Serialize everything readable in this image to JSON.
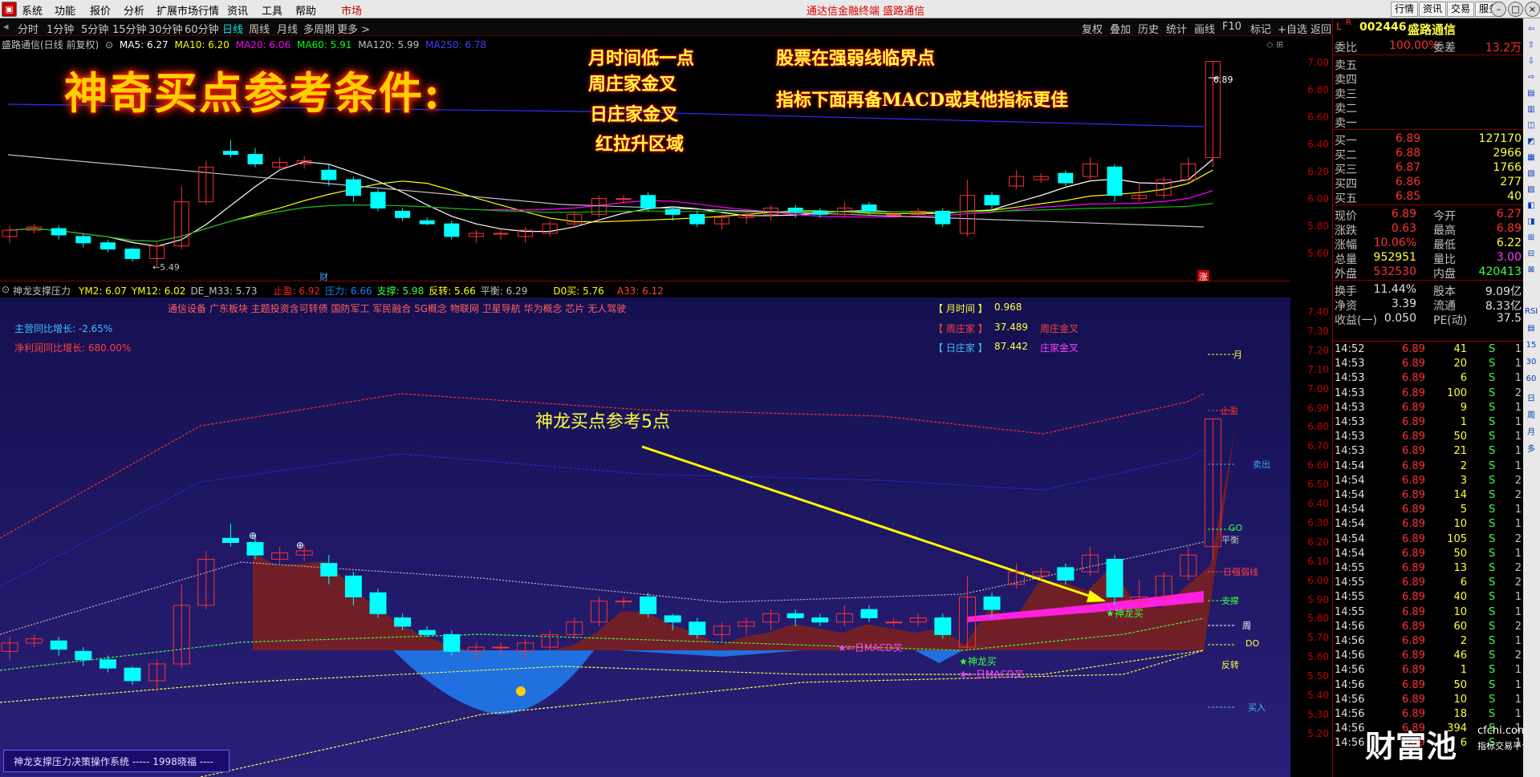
{
  "menubar": {
    "items": [
      "系统",
      "功能",
      "报价",
      "分析",
      "扩展市场行情",
      "资讯",
      "工具",
      "帮助"
    ],
    "market": "市场",
    "center_title": "通达信金融终端  盛路通信",
    "right_buttons": [
      "行情",
      "资讯",
      "交易",
      "服务"
    ]
  },
  "toolbar": {
    "periods": [
      "分时",
      "1分钟",
      "5分钟",
      "15分钟",
      "30分钟",
      "60分钟",
      "日线",
      "周线",
      "月线",
      "多周期",
      "更多 >"
    ],
    "active_period": "日线",
    "right_items": [
      "复权",
      "叠加",
      "历史",
      "统计",
      "画线",
      "F10",
      "标记",
      "+自选",
      "返回"
    ]
  },
  "main_chart": {
    "legend_title": "盛路通信(日线 前复权)",
    "legend": [
      {
        "label": "MA5: 6.27",
        "color": "#ffffff"
      },
      {
        "label": "MA10: 6.20",
        "color": "#ffff00"
      },
      {
        "label": "MA20: 6.06",
        "color": "#ff00ff"
      },
      {
        "label": "MA60: 5.91",
        "color": "#00ff00"
      },
      {
        "label": "MA120: 5.99",
        "color": "#c0c0c0"
      },
      {
        "label": "MA250: 6.78",
        "color": "#4040ff"
      }
    ],
    "big_title": "神奇买点参考条件:",
    "conditions_left": [
      "月时间低一点",
      "周庄家金叉",
      "日庄家金叉",
      "红拉升区域"
    ],
    "conditions_right": [
      "股票在强弱线临界点",
      "指标下面再备MACD或其他指标更佳"
    ],
    "high_label": "6.89",
    "low_label": "←5.49",
    "cai_label": "财",
    "zhang_label": "涨",
    "axis": [
      "7.00",
      "6.80",
      "6.60",
      "6.40",
      "6.20",
      "6.00",
      "5.80",
      "5.60"
    ]
  },
  "indicator": {
    "name": "神龙支撑压力",
    "params": [
      {
        "label": "YM2: 6.07",
        "color": "#ffff00"
      },
      {
        "label": "YM12: 6.02",
        "color": "#ffff00"
      },
      {
        "label": "DE_M33: 5.73",
        "color": "#c0c0c0"
      },
      {
        "label": "止盈: 6.92",
        "color": "#ff2020"
      },
      {
        "label": "压力: 6.66",
        "color": "#2080ff"
      },
      {
        "label": "支撑: 5.98",
        "color": "#40ff40"
      },
      {
        "label": "反转: 5.66",
        "color": "#ffff00"
      },
      {
        "label": "平衡: 6.29",
        "color": "#c0c0c0"
      },
      {
        "label": "D0买: 5.76",
        "color": "#ffff00"
      },
      {
        "label": "A33: 6.12",
        "color": "#ff4040"
      }
    ],
    "concepts": "通信设备 广东板块 主题投资含可转债 国防军工 军民融合 5G概念 物联网 卫星导航 华为概念 芯片 无人驾驶",
    "growth1": "主营同比增长: -2.65%",
    "growth2": "净利润同比增长: 680.00%",
    "info_rows": [
      {
        "tag": "【 月时间 】",
        "value": "0.968",
        "extra": ""
      },
      {
        "tag": "【 周庄家 】",
        "value": "37.489",
        "extra": "周庄金叉"
      },
      {
        "tag": "【 日庄家 】",
        "value": "87.442",
        "extra": "庄家金叉"
      }
    ],
    "annotation": "神龙买点参考5点",
    "labels": {
      "yue": "月",
      "zhiying": "止盈",
      "maichu": "卖出",
      "go": "GO",
      "pingheng": "平衡",
      "rqrx": "日强弱线",
      "zhicheng": "支撑",
      "zhou": "周",
      "do": "DO",
      "fanzhuan": "反转",
      "mairu": "买入",
      "shenlong1": "★神龙买",
      "shenlong2": "★神龙买",
      "macd1": "★←日MACD叉",
      "macd2": "★←日MACD叉"
    },
    "axis": [
      "7.40",
      "7.30",
      "7.20",
      "7.10",
      "7.00",
      "6.90",
      "6.80",
      "6.70",
      "6.60",
      "6.50",
      "6.40",
      "6.30",
      "6.20",
      "6.10",
      "6.00",
      "5.90",
      "5.80",
      "5.70",
      "5.60",
      "5.50",
      "5.40",
      "5.30",
      "5.20"
    ],
    "status": "神龙支撑压力决策操作系统  -----  1998晓福  ----"
  },
  "quote": {
    "code": "002446",
    "name": "盛路通信",
    "webi_label": "委比",
    "webi_value": "100.00%",
    "weicha_label": "委差",
    "weicha_value": "13.2万",
    "sells": [
      "卖五",
      "卖四",
      "卖三",
      "卖二",
      "卖一"
    ],
    "buys": [
      {
        "label": "买一",
        "price": "6.89",
        "vol": "127170"
      },
      {
        "label": "买二",
        "price": "6.88",
        "vol": "2966"
      },
      {
        "label": "买三",
        "price": "6.87",
        "vol": "1766"
      },
      {
        "label": "买四",
        "price": "6.86",
        "vol": "277"
      },
      {
        "label": "买五",
        "price": "6.85",
        "vol": "40"
      }
    ],
    "stats": [
      {
        "l1": "现价",
        "v1": "6.89",
        "l2": "今开",
        "v2": "6.27",
        "c1": "#ff3030",
        "c2": "#ff3030"
      },
      {
        "l1": "涨跌",
        "v1": "0.63",
        "l2": "最高",
        "v2": "6.89",
        "c1": "#ff3030",
        "c2": "#ff3030"
      },
      {
        "l1": "涨幅",
        "v1": "10.06%",
        "l2": "最低",
        "v2": "6.22",
        "c1": "#ff3030",
        "c2": "#ffff40"
      },
      {
        "l1": "总量",
        "v1": "952951",
        "l2": "量比",
        "v2": "3.00",
        "c1": "#ffff40",
        "c2": "#ff40ff"
      },
      {
        "l1": "外盘",
        "v1": "532530",
        "l2": "内盘",
        "v2": "420413",
        "c1": "#ff3030",
        "c2": "#40ff40"
      }
    ],
    "stats2": [
      {
        "l1": "换手",
        "v1": "11.44%",
        "l2": "股本",
        "v2": "9.09亿"
      },
      {
        "l1": "净资",
        "v1": "3.39",
        "l2": "流通",
        "v2": "8.33亿"
      },
      {
        "l1": "收益(一)",
        "v1": "0.050",
        "l2": "PE(动)",
        "v2": "37.5"
      }
    ],
    "ticks": [
      [
        "14:52",
        "6.89",
        "41",
        "S",
        "1"
      ],
      [
        "14:53",
        "6.89",
        "20",
        "S",
        "1"
      ],
      [
        "14:53",
        "6.89",
        "6",
        "S",
        "1"
      ],
      [
        "14:53",
        "6.89",
        "100",
        "S",
        "2"
      ],
      [
        "14:53",
        "6.89",
        "9",
        "S",
        "1"
      ],
      [
        "14:53",
        "6.89",
        "1",
        "S",
        "1"
      ],
      [
        "14:53",
        "6.89",
        "50",
        "S",
        "1"
      ],
      [
        "14:53",
        "6.89",
        "21",
        "S",
        "1"
      ],
      [
        "14:54",
        "6.89",
        "2",
        "S",
        "1"
      ],
      [
        "14:54",
        "6.89",
        "3",
        "S",
        "2"
      ],
      [
        "14:54",
        "6.89",
        "14",
        "S",
        "2"
      ],
      [
        "14:54",
        "6.89",
        "5",
        "S",
        "1"
      ],
      [
        "14:54",
        "6.89",
        "10",
        "S",
        "1"
      ],
      [
        "14:54",
        "6.89",
        "105",
        "S",
        "2"
      ],
      [
        "14:54",
        "6.89",
        "50",
        "S",
        "1"
      ],
      [
        "14:55",
        "6.89",
        "13",
        "S",
        "2"
      ],
      [
        "14:55",
        "6.89",
        "6",
        "S",
        "2"
      ],
      [
        "14:55",
        "6.89",
        "40",
        "S",
        "1"
      ],
      [
        "14:55",
        "6.89",
        "10",
        "S",
        "1"
      ],
      [
        "14:56",
        "6.89",
        "60",
        "S",
        "2"
      ],
      [
        "14:56",
        "6.89",
        "2",
        "S",
        "1"
      ],
      [
        "14:56",
        "6.89",
        "46",
        "S",
        "2"
      ],
      [
        "14:56",
        "6.89",
        "1",
        "S",
        "1"
      ],
      [
        "14:56",
        "6.89",
        "50",
        "S",
        "1"
      ],
      [
        "14:56",
        "6.89",
        "10",
        "S",
        "1"
      ],
      [
        "14:56",
        "6.89",
        "18",
        "S",
        "1"
      ],
      [
        "14:56",
        "6.89",
        "394",
        "S",
        "1"
      ],
      [
        "14:56",
        "6.89",
        "6",
        "S",
        "1"
      ]
    ]
  },
  "watermark": {
    "big": "财富池",
    "small": "cfchi.com",
    "sub": "指标交易平台"
  },
  "colors": {
    "up": "#ff3030",
    "down": "#00ffff",
    "bg": "#000000",
    "ind_bg": "#1e1a6e"
  }
}
